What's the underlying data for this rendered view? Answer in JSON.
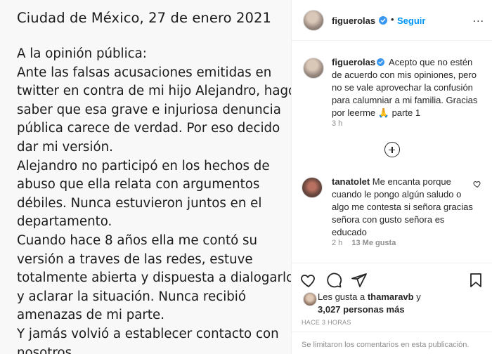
{
  "image": {
    "date_line": "Ciudad de México, 27 de enero 2021",
    "body_lines": [
      "A la opinión pública:",
      "Ante las falsas acusaciones emitidas en",
      "twitter en contra de mi hijo Alejandro, hago",
      "saber que esa grave e injuriosa denuncia",
      "pública carece de verdad. Por eso decido",
      "dar mi versión.",
      "Alejandro no participó en los hechos de",
      "abuso que ella relata con argumentos",
      "débiles. Nunca estuvieron juntos en el",
      "departamento.",
      "Cuando hace 8 años ella me contó su",
      "versión a traves de las redes, estuve",
      "totalmente abierta y dispuesta a dialogarlo",
      "y aclarar la situación. Nunca recibió",
      "amenazas de mi parte.",
      "Y jamás volvió a establecer contacto con",
      "nosotros."
    ]
  },
  "header": {
    "username": "figuerolas",
    "separator": "•",
    "follow_label": "Seguir",
    "more_icon": "..."
  },
  "caption": {
    "username": "figuerolas",
    "text_before": "Acepto que no estén de acuerdo con mis opiniones, pero no se vale aprovechar la confusión para calumniar a mi familia. Gracias por leerme",
    "emoji": "🙏",
    "text_after": "parte 1",
    "time": "3 h"
  },
  "comment": {
    "username": "tanatolet",
    "text": "Me encanta porque cuando le pongo algún saludo o algo me contesta si señora gracias señora con gusto señora es educado",
    "time": "2 h",
    "likes": "13 Me gusta"
  },
  "likes": {
    "prefix": "Les gusta a",
    "user": "thamaravb",
    "connector": "y",
    "count": "3,027 personas más"
  },
  "post_time": "Hace 3 horas",
  "footer": {
    "text": "Se limitaron los comentarios en esta publicación."
  },
  "colors": {
    "accent": "#0095f6",
    "text": "#262626",
    "muted": "#8e8e8e",
    "border": "#efefef"
  },
  "icons": [
    "verified-icon",
    "more-icon",
    "load-more-icon",
    "heart-icon",
    "comment-icon",
    "share-icon",
    "bookmark-icon"
  ]
}
